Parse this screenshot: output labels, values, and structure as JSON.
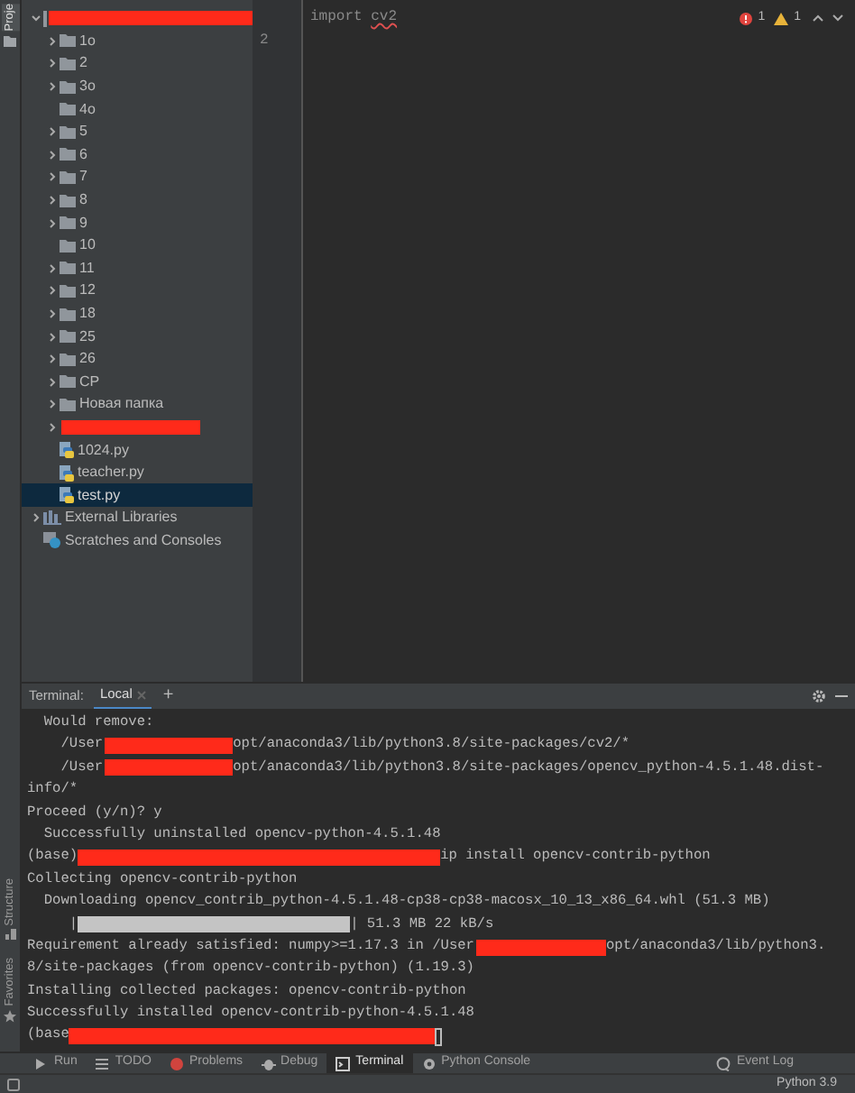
{
  "left_strip": {
    "top_tab": "Proje",
    "bottom_tabs": [
      "Structure",
      "Favorites"
    ]
  },
  "project_tree": [
    {
      "kind": "redacted",
      "expanded": true,
      "selected": false,
      "children": [
        {
          "kind": "folder",
          "label": "1o",
          "expanded": false,
          "selected": false
        },
        {
          "kind": "folder",
          "label": "2",
          "expanded": false,
          "selected": false
        },
        {
          "kind": "folder",
          "label": "3o",
          "expanded": false,
          "selected": false
        },
        {
          "kind": "folder",
          "label": "4o",
          "selected": false
        },
        {
          "kind": "folder",
          "label": "5",
          "expanded": false,
          "selected": false
        },
        {
          "kind": "folder",
          "label": "6",
          "expanded": false,
          "selected": false
        },
        {
          "kind": "folder",
          "label": "7",
          "expanded": false,
          "selected": false
        },
        {
          "kind": "folder",
          "label": "8",
          "expanded": false,
          "selected": false
        },
        {
          "kind": "folder",
          "label": "9",
          "expanded": false,
          "selected": false
        },
        {
          "kind": "folder",
          "label": "10",
          "selected": false
        },
        {
          "kind": "folder",
          "label": "11",
          "expanded": false,
          "selected": false
        },
        {
          "kind": "folder",
          "label": "12",
          "expanded": false,
          "selected": false
        },
        {
          "kind": "folder",
          "label": "18",
          "expanded": false,
          "selected": false
        },
        {
          "kind": "folder",
          "label": "25",
          "expanded": false,
          "selected": false
        },
        {
          "kind": "folder",
          "label": "26",
          "expanded": false,
          "selected": false
        },
        {
          "kind": "folder",
          "label": "CP",
          "expanded": false,
          "selected": false
        },
        {
          "kind": "folder",
          "label": "Новая папка",
          "expanded": false,
          "selected": false
        },
        {
          "kind": "redacted",
          "expanded": false,
          "selected": false
        },
        {
          "kind": "python",
          "label": "1024.py",
          "selected": false
        },
        {
          "kind": "python",
          "label": "teacher.py",
          "selected": false
        },
        {
          "kind": "python",
          "label": "test.py",
          "selected": true
        }
      ]
    },
    {
      "kind": "library",
      "label": "External Libraries",
      "expanded": false,
      "selected": false
    },
    {
      "kind": "scratches",
      "label": "Scratches and Consoles",
      "selected": false
    }
  ],
  "editor": {
    "lines": [
      {
        "tokens": [
          {
            "kind": "keyword",
            "text": "import"
          },
          {
            "kind": "error",
            "text": "cv2"
          }
        ]
      },
      {
        "number": "2"
      }
    ],
    "inspections": {
      "errors": "1",
      "warnings": "1"
    }
  },
  "terminal": {
    "title": "Terminal:",
    "tabs": [
      {
        "label": "Local",
        "selected": true
      }
    ],
    "add_tab": "+",
    "lines": [
      [
        {
          "kind": "text",
          "text": "  Would remove:"
        }
      ],
      [
        {
          "kind": "text",
          "text": "    /User"
        },
        {
          "kind": "redaction"
        },
        {
          "kind": "text",
          "text": "opt/anaconda3/lib/python3.8/site-packages/cv2/*"
        }
      ],
      [
        {
          "kind": "text",
          "text": "    /User"
        },
        {
          "kind": "redaction"
        },
        {
          "kind": "text",
          "text": "opt/anaconda3/lib/python3.8/site-packages/opencv_python-4.5.1.48.dist-"
        }
      ],
      [
        {
          "kind": "text",
          "text": "info/*"
        }
      ],
      [
        {
          "kind": "text",
          "text": "Proceed (y/n)? y"
        }
      ],
      [
        {
          "kind": "text",
          "text": "  Successfully uninstalled opencv-python-4.5.1.48"
        }
      ],
      [
        {
          "kind": "text",
          "text": "(base)"
        },
        {
          "kind": "redaction"
        },
        {
          "kind": "text",
          "text": "ip install opencv-contrib-python"
        }
      ],
      [
        {
          "kind": "text",
          "text": "Collecting opencv-contrib-python"
        }
      ],
      [
        {
          "kind": "text",
          "text": "  Downloading opencv_contrib_python-4.5.1.48-cp38-cp38-macosx_10_13_x86_64.whl (51.3 MB)"
        }
      ],
      [
        {
          "kind": "text",
          "text": "     |"
        },
        {
          "kind": "progress",
          "level": 1
        },
        {
          "kind": "text",
          "text": "| 51.3 MB 22 kB/s"
        }
      ],
      [
        {
          "kind": "text",
          "text": "Requirement already satisfied: numpy>=1.17.3 in /User"
        },
        {
          "kind": "redaction"
        },
        {
          "kind": "text",
          "text": "opt/anaconda3/lib/python3."
        }
      ],
      [
        {
          "kind": "text",
          "text": "8/site-packages (from opencv-contrib-python) (1.19.3)"
        }
      ],
      [
        {
          "kind": "text",
          "text": "Installing collected packages: opencv-contrib-python"
        }
      ],
      [
        {
          "kind": "text",
          "text": "Successfully installed opencv-contrib-python-4.5.1.48"
        }
      ],
      [
        {
          "kind": "text",
          "text": "(base"
        },
        {
          "kind": "redaction"
        },
        {
          "kind": "cursor"
        }
      ]
    ]
  },
  "tool_windows": [
    {
      "label": "Run",
      "selected": false
    },
    {
      "label": "TODO",
      "selected": false
    },
    {
      "label": "Problems",
      "selected": false
    },
    {
      "label": "Debug",
      "selected": false
    },
    {
      "label": "Terminal",
      "selected": true
    },
    {
      "label": "Python Console",
      "selected": false
    }
  ],
  "event_log": "Event Log",
  "status_bar": {
    "interpreter": "Python 3.9"
  }
}
